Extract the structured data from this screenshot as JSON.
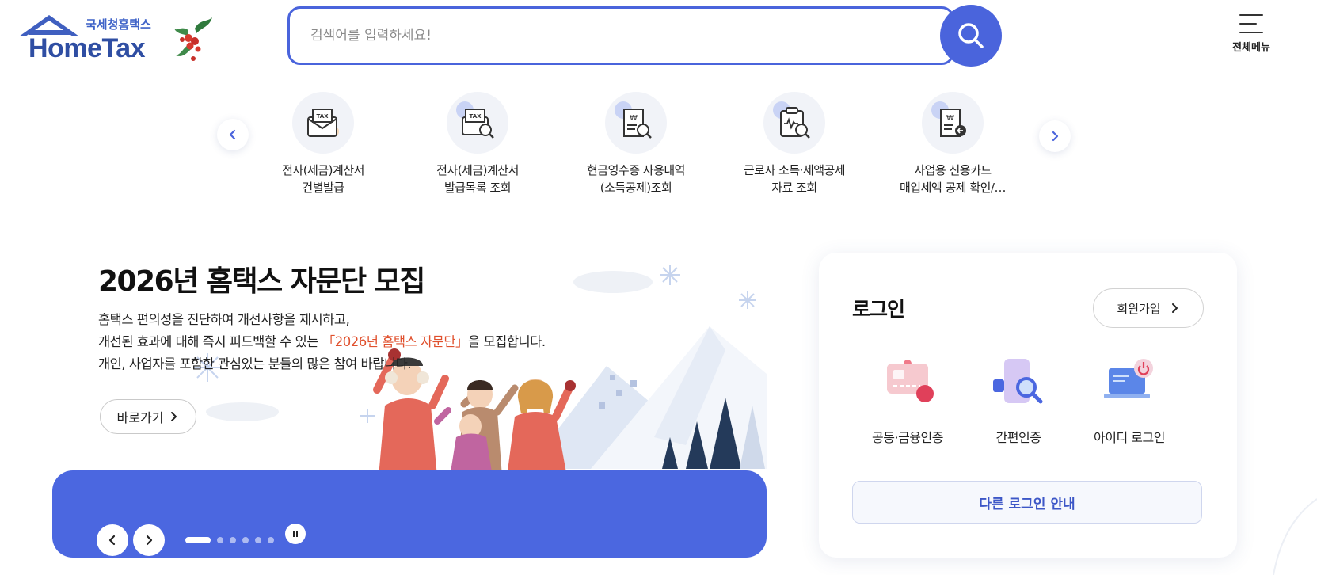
{
  "logo": {
    "sub": "국세청홈택스",
    "main": "HomeTax"
  },
  "search": {
    "placeholder": "검색어를 입력하세요!",
    "value": ""
  },
  "menu": {
    "label": "전체메뉴"
  },
  "quick_menu": [
    {
      "line1": "전자(세금)계산서",
      "line2": "건별발급",
      "icon": "tax-envelope-icon"
    },
    {
      "line1": "전자(세금)계산서",
      "line2": "발급목록 조회",
      "icon": "tax-search-icon"
    },
    {
      "line1": "현금영수증 사용내역",
      "line2": "(소득공제)조회",
      "icon": "receipt-search-icon"
    },
    {
      "line1": "근로자 소득·세액공제",
      "line2": "자료 조회",
      "icon": "clipboard-search-icon"
    },
    {
      "line1": "사업용 신용카드",
      "line2": "매입세액 공제 확인/…",
      "icon": "receipt-add-icon"
    }
  ],
  "banner": {
    "title": "2026년 홈택스 자문단 모집",
    "desc_line1": "홈택스 편의성을 진단하여 개선사항을 제시하고,",
    "desc_line2_pre": "개선된 효과에 대해 즉시 피드백할 수 있는 ",
    "desc_line2_hl": "「2026년 홈택스 자문단」",
    "desc_line2_post": "을 모집합니다.",
    "desc_line3": "개인, 사업자를 포함한 관심있는 분들의 많은 참여 바랍니다.",
    "go_label": "바로가기",
    "slide_count": 6,
    "active_slide": 1
  },
  "login": {
    "title": "로그인",
    "signup_label": "회원가입",
    "options": [
      {
        "label": "공동·금융인증",
        "icon": "certificate-card-icon"
      },
      {
        "label": "간편인증",
        "icon": "simple-auth-icon"
      },
      {
        "label": "아이디 로그인",
        "icon": "laptop-power-icon"
      }
    ],
    "other_label": "다른 로그인 안내"
  },
  "colors": {
    "accent": "#4a64dc",
    "highlight": "#e0502d"
  }
}
